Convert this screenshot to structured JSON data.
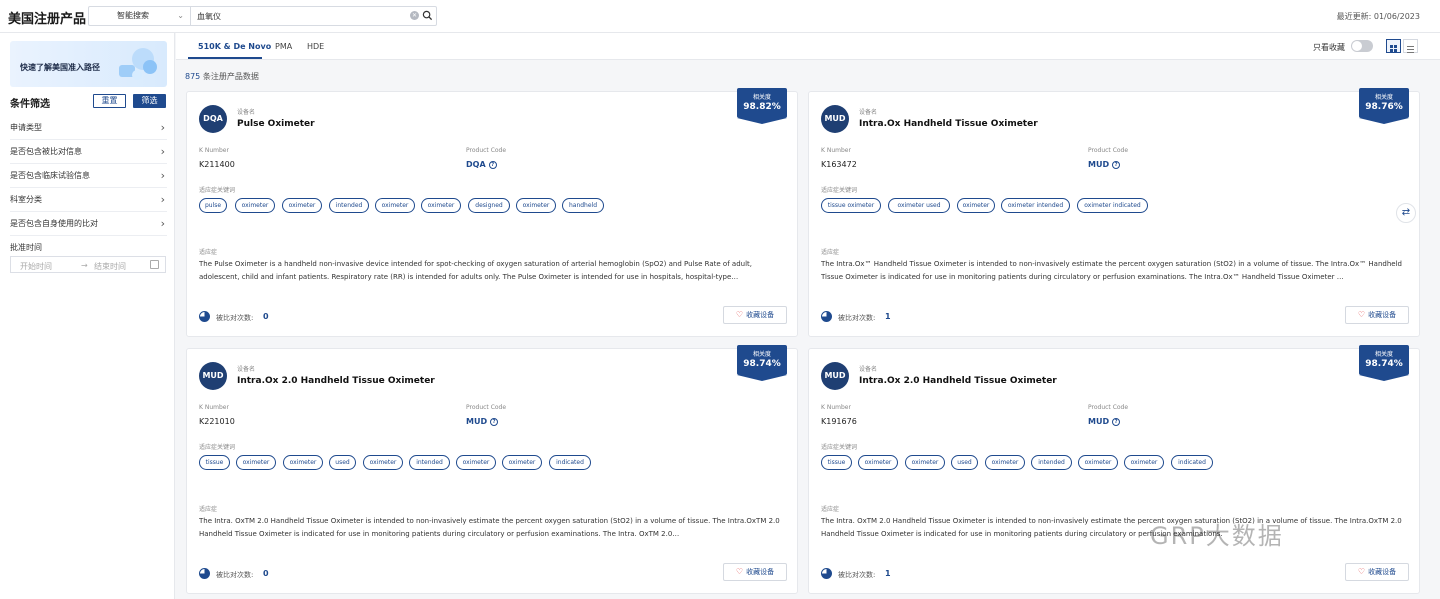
{
  "app": {
    "title": "美国注册产品"
  },
  "search": {
    "mode": "智能搜索",
    "query": "血氧仪",
    "placeholder": ""
  },
  "header": {
    "last_update": "最近更新: 01/06/2023"
  },
  "sidebar": {
    "banner_text": "快速了解美国准入路径",
    "filter_title": "条件筛选",
    "reset_label": "重置",
    "filter_label": "筛选",
    "filters": [
      "申请类型",
      "是否包含被比对信息",
      "是否包含临床试验信息",
      "科室分类",
      "是否包含自身使用的比对"
    ],
    "date_label": "批准时间",
    "date_start_placeholder": "开始时间",
    "date_end_placeholder": "结束时间",
    "date_arrow": "→"
  },
  "tabs": [
    {
      "label": "510K & De Novo",
      "active": true
    },
    {
      "label": "PMA",
      "active": false
    },
    {
      "label": "HDE",
      "active": false
    }
  ],
  "toolbar": {
    "fav_only_label": "只看收藏"
  },
  "results": {
    "count": "875",
    "count_suffix": " 条注册产品数据"
  },
  "labels": {
    "device_name": "设备名",
    "k_number": "K Number",
    "product_code": "Product Code",
    "keywords": "适应症关键词",
    "indication": "适应症",
    "compared_times": "被比对次数:",
    "favorite": "收藏设备",
    "relevance": "相关度"
  },
  "cards": [
    {
      "avatar": "DQA",
      "name": "Pulse Oximeter",
      "k_number": "K211400",
      "product_code": "DQA",
      "relevance": "98.82%",
      "keywords": [
        "pulse",
        "oximeter",
        "oximeter",
        "intended",
        "oximeter",
        "oximeter",
        "designed",
        "oximeter",
        "handheld"
      ],
      "indication": "The Pulse Oximeter is a handheld non-invasive device intended for spot-checking of oxygen saturation of arterial hemoglobin (SpO2) and Pulse Rate of adult, adolescent, child and infant patients. Respiratory rate (RR) is intended for adults only. The Pulse Oximeter is intended for use in hospitals, hospital-type…",
      "compared": "0"
    },
    {
      "avatar": "MUD",
      "name": "Intra.Ox Handheld Tissue Oximeter",
      "k_number": "K163472",
      "product_code": "MUD",
      "relevance": "98.76%",
      "keywords": [
        "tissue oximeter",
        "oximeter used",
        "oximeter",
        "oximeter intended",
        "oximeter indicated"
      ],
      "indication": "The Intra.Ox™ Handheld Tissue Oximeter is intended to non-invasively estimate the percent oxygen saturation (StO2) in a volume of tissue. The Intra.Ox™ Handheld Tissue Oximeter is indicated for use in monitoring patients during circulatory or perfusion examinations. The Intra.Ox™ Handheld Tissue Oximeter …",
      "compared": "1"
    },
    {
      "avatar": "MUD",
      "name": "Intra.Ox 2.0 Handheld Tissue Oximeter",
      "k_number": "K221010",
      "product_code": "MUD",
      "relevance": "98.74%",
      "keywords": [
        "tissue",
        "oximeter",
        "oximeter",
        "used",
        "oximeter",
        "intended",
        "oximeter",
        "oximeter",
        "indicated"
      ],
      "indication": "The Intra. OxTM 2.0 Handheld Tissue Oximeter is intended to non-invasively estimate the percent oxygen saturation (StO2) in a volume of tissue. The Intra.OxTM 2.0 Handheld Tissue Oximeter is indicated for use in monitoring patients during circulatory or perfusion examinations. The Intra. OxTM 2.0…",
      "compared": "0"
    },
    {
      "avatar": "MUD",
      "name": "Intra.Ox 2.0 Handheld Tissue Oximeter",
      "k_number": "K191676",
      "product_code": "MUD",
      "relevance": "98.74%",
      "keywords": [
        "tissue",
        "oximeter",
        "oximeter",
        "used",
        "oximeter",
        "intended",
        "oximeter",
        "oximeter",
        "indicated"
      ],
      "indication": "The Intra. OxTM 2.0 Handheld Tissue Oximeter is intended to non-invasively estimate the percent oxygen saturation (StO2) in a volume of tissue. The Intra.OxTM 2.0 Handheld Tissue Oximeter is indicated for use in monitoring patients during circulatory or perfusion examinations.",
      "compared": "1"
    }
  ],
  "watermark": "GRP大数据"
}
